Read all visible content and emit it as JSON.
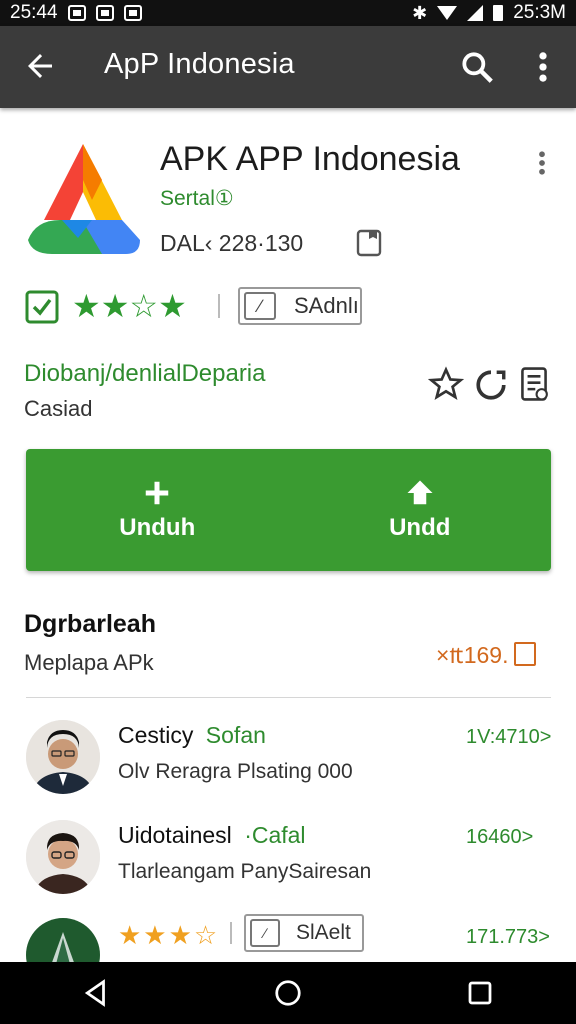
{
  "status_bar": {
    "time_left": "25:44",
    "time_right": "25:3M"
  },
  "app_bar": {
    "title": "ApP Indonesia"
  },
  "app": {
    "name": "APK APP Indonesia",
    "developer": "Sertal①",
    "size": "DAL‹ 228·130"
  },
  "rating": {
    "stars": "★★☆★",
    "chip_label": "SAdnlı"
  },
  "category": {
    "title": "Diobanj/denlialDeparia",
    "subtitle": "Casiad"
  },
  "download": {
    "left_label": "Unduh",
    "right_label": "Undd"
  },
  "section": {
    "title": "Dgrbarleah",
    "subtitle": "Meplapa APk",
    "count": "×₶169."
  },
  "reviews": [
    {
      "name": "Cesticy",
      "tag": "Sofan",
      "text": "Olv Reragra Plsating 000",
      "meta": "1V:4710>"
    },
    {
      "name": "Uidotainesl",
      "tag": "·Cafal",
      "text": "Tlarleangam PanySairesan",
      "meta": "16460>"
    },
    {
      "stars": "★★★☆",
      "chip_label": "SlAelt",
      "meta": "171.773>"
    }
  ],
  "colors": {
    "accent_green": "#3a9b31",
    "app_bar": "#3b3b3b",
    "orange": "#d2691e"
  }
}
